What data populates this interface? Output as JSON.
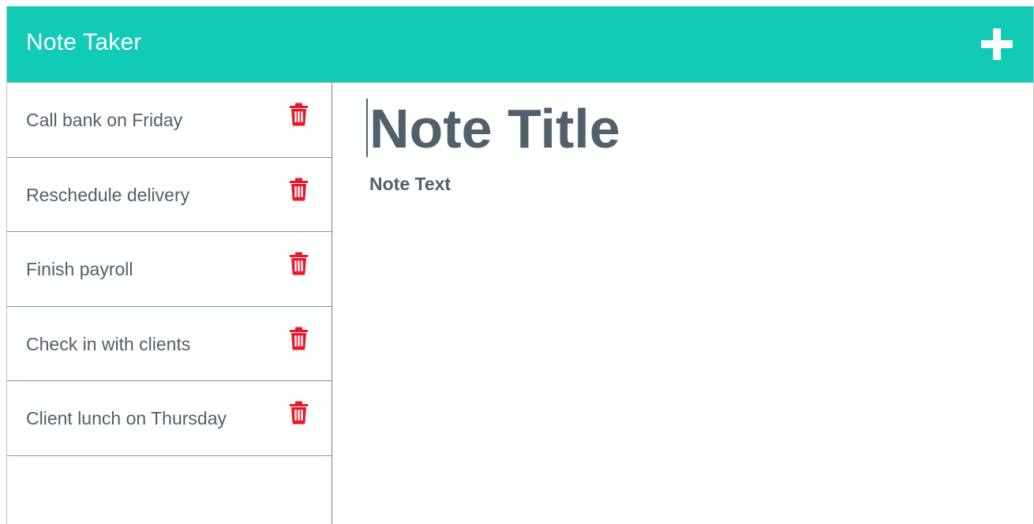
{
  "app": {
    "title": "Note Taker"
  },
  "toolbar": {
    "new_note_icon": "plus-icon"
  },
  "notes": [
    {
      "title": "Call bank on Friday",
      "delete_icon": "trash-icon"
    },
    {
      "title": "Reschedule delivery",
      "delete_icon": "trash-icon"
    },
    {
      "title": "Finish payroll",
      "delete_icon": "trash-icon"
    },
    {
      "title": "Check in with clients",
      "delete_icon": "trash-icon"
    },
    {
      "title": "Client lunch on Thursday",
      "delete_icon": "trash-icon"
    }
  ],
  "editor": {
    "title_placeholder": "Note Title",
    "title_value": "",
    "text_placeholder": "Note Text",
    "text_value": ""
  },
  "colors": {
    "navbar": "#12cbb6",
    "text": "#52606b",
    "delete": "#e8182a",
    "border": "#7f95a5"
  }
}
